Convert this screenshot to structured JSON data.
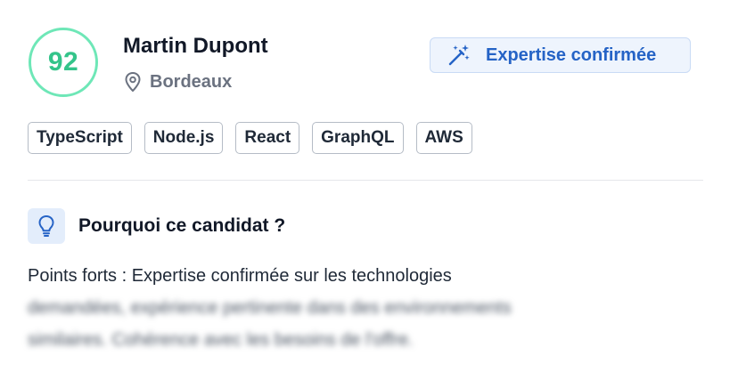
{
  "candidate": {
    "score": "92",
    "name": "Martin Dupont",
    "location": "Bordeaux",
    "badge": "Expertise confirmée",
    "tags": [
      "TypeScript",
      "Node.js",
      "React",
      "GraphQL",
      "AWS"
    ]
  },
  "why": {
    "title": "Pourquoi ce candidat ?",
    "line1": "Points forts : Expertise confirmée sur les technologies",
    "line2": "demandées, expérience pertinente dans des environnements",
    "line3": "similaires. Cohérence avec les besoins de l'offre."
  },
  "colors": {
    "score_ring": "#6ee7b7",
    "score_text": "#34c48a",
    "badge_bg": "#eef4fd",
    "badge_text": "#2563c6"
  },
  "icons": {
    "location": "map-pin-icon",
    "badge": "magic-wand-icon",
    "why": "lightbulb-icon"
  }
}
